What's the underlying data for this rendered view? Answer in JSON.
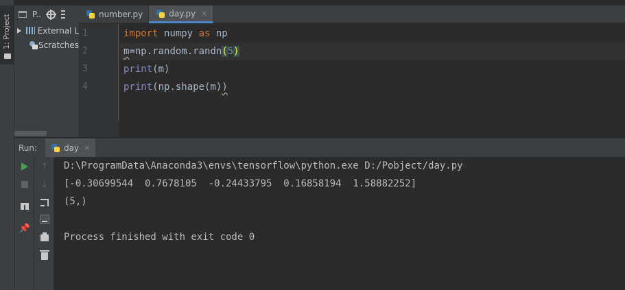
{
  "left_strip": {
    "project_tab_label": "1: Project"
  },
  "project_panel": {
    "toolbar_label": "P..",
    "tree": [
      {
        "label": "External L",
        "icon": "library-icon",
        "expandable": true
      },
      {
        "label": "Scratches",
        "icon": "scratches-icon",
        "expandable": false
      }
    ]
  },
  "editor_tabs": [
    {
      "label": "number.py",
      "active": false
    },
    {
      "label": "day.py",
      "active": true,
      "close": "×"
    }
  ],
  "editor": {
    "line_numbers": [
      "1",
      "2",
      "3",
      "4"
    ],
    "lines": [
      {
        "tokens": [
          {
            "t": "import",
            "c": "kw"
          },
          {
            "t": " numpy ",
            "c": ""
          },
          {
            "t": "as",
            "c": "kw"
          },
          {
            "t": " np",
            "c": ""
          }
        ]
      },
      {
        "tokens": [
          {
            "t": "m",
            "c": "warn-ul"
          },
          {
            "t": "=np.random.randn",
            "c": ""
          },
          {
            "t": "(",
            "c": "paren-hl"
          },
          {
            "t": "5",
            "c": "num"
          },
          {
            "t": ")",
            "c": "paren-hl"
          }
        ]
      },
      {
        "tokens": [
          {
            "t": "print",
            "c": "bi"
          },
          {
            "t": "(m)",
            "c": ""
          }
        ]
      },
      {
        "tokens": [
          {
            "t": "print",
            "c": "bi"
          },
          {
            "t": "(np.shape(m)",
            "c": ""
          },
          {
            "t": ")",
            "c": "warn-ul"
          }
        ]
      }
    ]
  },
  "run_panel": {
    "label": "Run:",
    "tab_label": "day",
    "tab_close": "×",
    "output": [
      "D:\\ProgramData\\Anaconda3\\envs\\tensorflow\\python.exe D:/Pobject/day.py",
      "[-0.30699544  0.7678105  -0.24433795  0.16858194  1.58882252]",
      "(5,)",
      "",
      "Process finished with exit code 0"
    ]
  },
  "colors": {
    "keyword": "#cc7832",
    "builtin": "#8888c6",
    "number": "#6897bb",
    "run_green": "#499c54"
  }
}
